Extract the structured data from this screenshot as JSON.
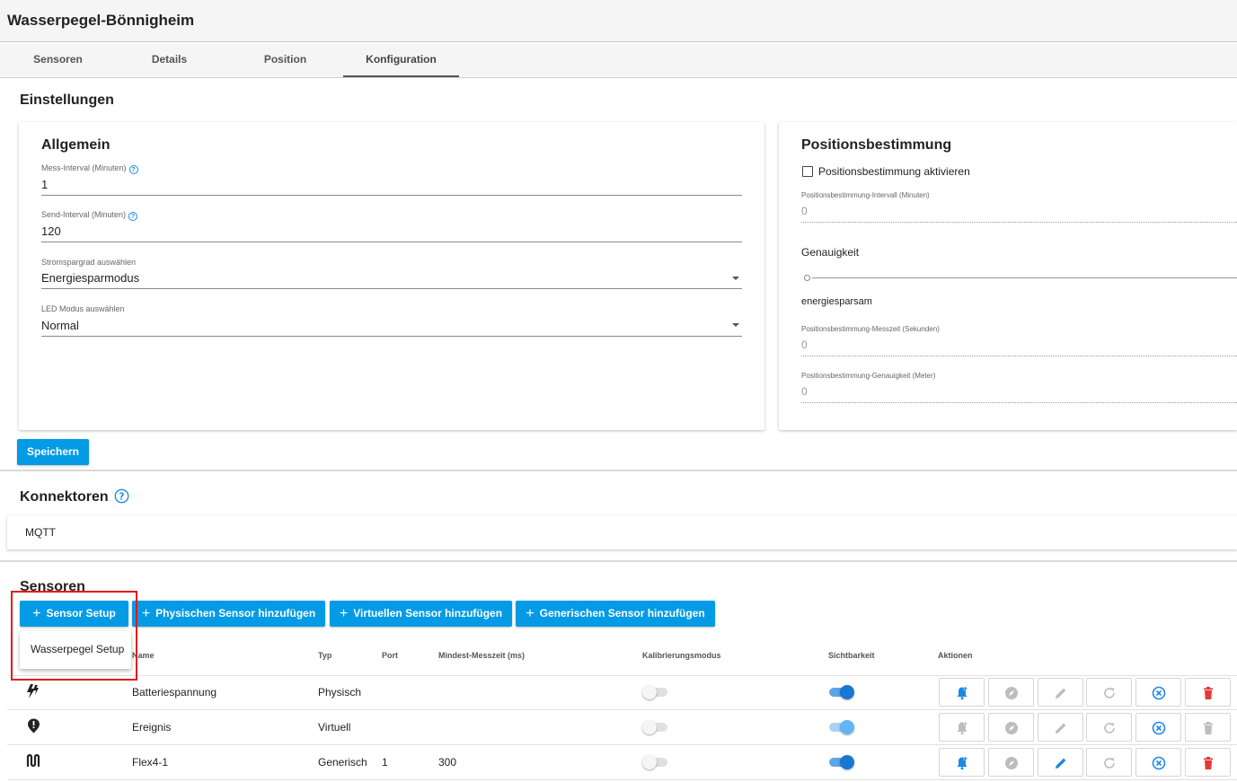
{
  "window_title": "Wasserpegel-Bönnigheim",
  "tabs": [
    {
      "label": "Sensoren"
    },
    {
      "label": "Details"
    },
    {
      "label": "Position"
    },
    {
      "label": "Konfiguration"
    }
  ],
  "settings": {
    "title": "Einstellungen",
    "general": {
      "title": "Allgemein",
      "measure_interval": {
        "label": "Mess-Interval (Minuten)",
        "value": "1"
      },
      "send_interval": {
        "label": "Send-Interval (Minuten)",
        "value": "120"
      },
      "power_mode": {
        "label": "Stromspargrad auswählen",
        "value": "Energiesparmodus"
      },
      "led_mode": {
        "label": "LED Modus auswählen",
        "value": "Normal"
      }
    },
    "positioning": {
      "title": "Positionsbestimmung",
      "enable_label": "Positionsbestimmung aktivieren",
      "enabled": false,
      "interval": {
        "label": "Positionsbestimmung-Intervall (Minuten)",
        "value": "0"
      },
      "accuracy_title": "Genauigkeit",
      "accuracy_value": "energiesparsam",
      "measure_time": {
        "label": "Positionsbestimmung-Messzeit (Sekunden)",
        "value": "0"
      },
      "precision": {
        "label": "Positionsbestimmung-Genauigkeit (Meter)",
        "value": "0"
      }
    },
    "save_label": "Speichern"
  },
  "connectors": {
    "title": "Konnektoren",
    "items": [
      "MQTT"
    ]
  },
  "sensors": {
    "title": "Sensoren",
    "buttons": {
      "setup": "Sensor Setup",
      "add_physical": "Physischen Sensor hinzufügen",
      "add_virtual": "Virtuellen Sensor hinzufügen",
      "add_generic": "Generischen Sensor hinzufügen"
    },
    "setup_menu": [
      "Wasserpegel Setup"
    ],
    "columns": {
      "name": "Name",
      "type": "Typ",
      "port": "Port",
      "min_time": "Mindest-Messzeit (ms)",
      "calibration": "Kalibrierungsmodus",
      "visibility": "Sichtbarkeit",
      "actions": "Aktionen"
    },
    "rows": [
      {
        "icon": "lightning-icon",
        "name": "Batteriespannung",
        "type": "Physisch",
        "port": "",
        "min_time": "",
        "calibration": false,
        "visible": true
      },
      {
        "icon": "alert-pin-icon",
        "name": "Ereignis",
        "type": "Virtuell",
        "port": "",
        "min_time": "",
        "calibration": false,
        "visible": true
      },
      {
        "icon": "waveform-icon",
        "name": "Flex4-1",
        "type": "Generisch",
        "port": "1",
        "min_time": "300",
        "calibration": false,
        "visible": true
      }
    ]
  },
  "colors": {
    "primary": "#039be5",
    "danger": "#e53935",
    "highlight_box": "#e31b1b"
  }
}
